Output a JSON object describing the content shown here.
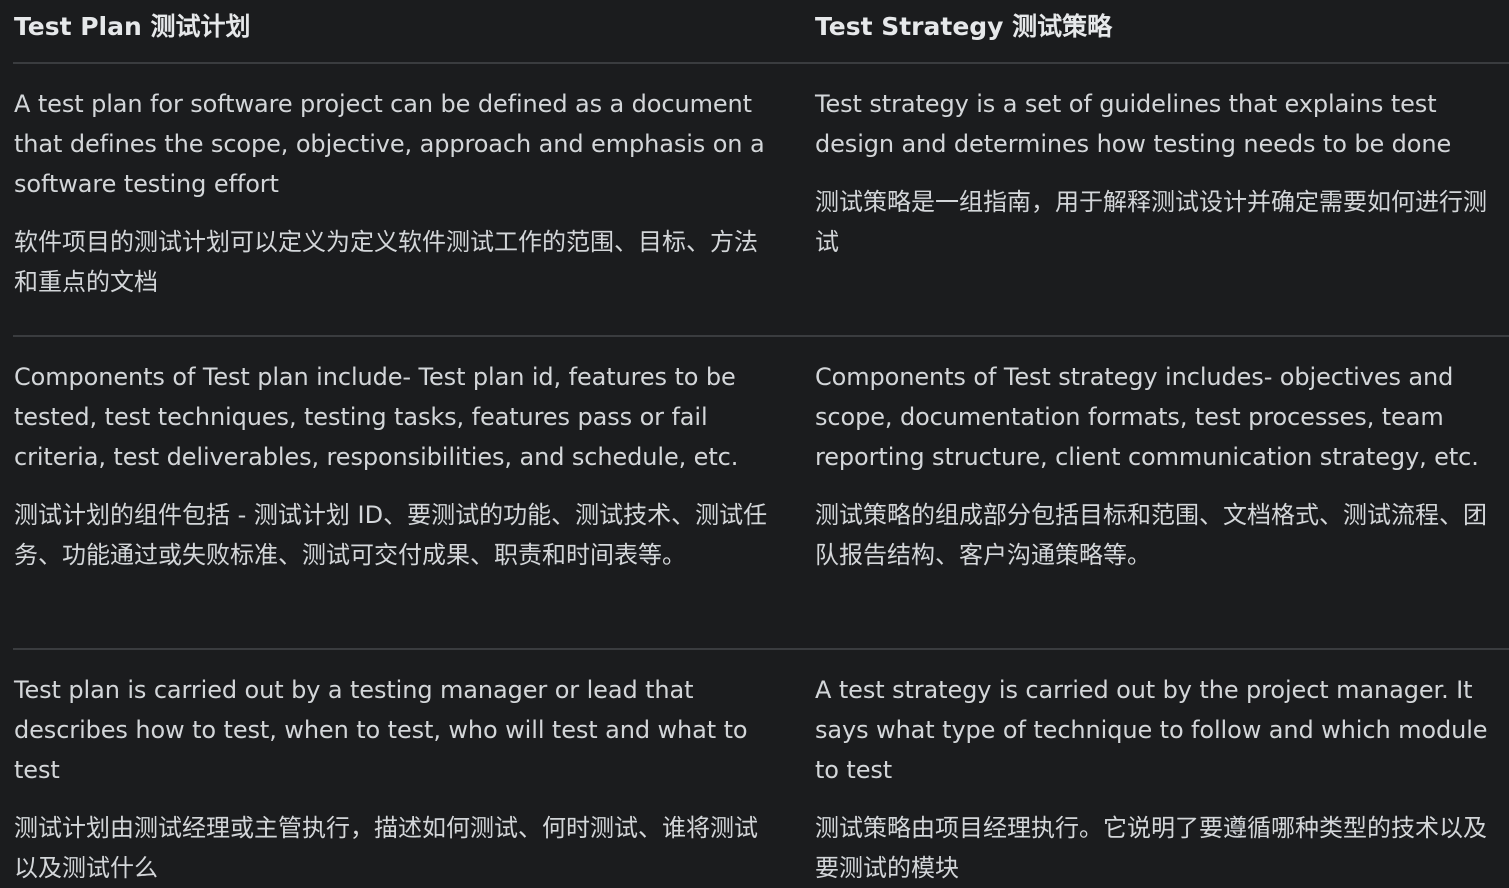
{
  "table": {
    "headers": [
      "Test Plan 测试计划",
      "Test Strategy 测试策略"
    ],
    "rows": [
      [
        {
          "en": "A test plan for software project can be defined as a document that defines the scope, objective, approach and emphasis on a software testing effort",
          "zh": "软件项目的测试计划可以定义为定义软件测试工作的范围、目标、方法和重点的文档"
        },
        {
          "en": "Test strategy is a set of guidelines that explains test design and determines how testing needs to be done",
          "zh": "测试策略是一组指南，用于解释测试设计并确定需要如何进行测试"
        }
      ],
      [
        {
          "en": "Components of Test plan include- Test plan id, features to be tested, test techniques, testing tasks, features pass or fail criteria, test deliverables, responsibilities, and schedule, etc.",
          "zh": "测试计划的组件包括 - 测试计划 ID、要测试的功能、测试技术、测试任务、功能通过或失败标准、测试可交付成果、职责和时间表等。"
        },
        {
          "en": "Components of Test strategy includes- objectives and scope, documentation formats, test processes, team reporting structure, client communication strategy, etc.",
          "zh": "测试策略的组成部分包括目标和范围、文档格式、测试流程、团队报告结构、客户沟通策略等。"
        }
      ],
      [
        {
          "en": "Test plan is carried out by a testing manager or lead that describes how to test, when to test, who will test and what to test",
          "zh": "测试计划由测试经理或主管执行，描述如何测试、何时测试、谁将测试以及测试什么"
        },
        {
          "en": "A test strategy is carried out by the project manager. It says what type of technique to follow and which module to test",
          "zh": "测试策略由项目经理执行。它说明了要遵循哪种类型的技术以及要测试的模块"
        }
      ]
    ]
  }
}
